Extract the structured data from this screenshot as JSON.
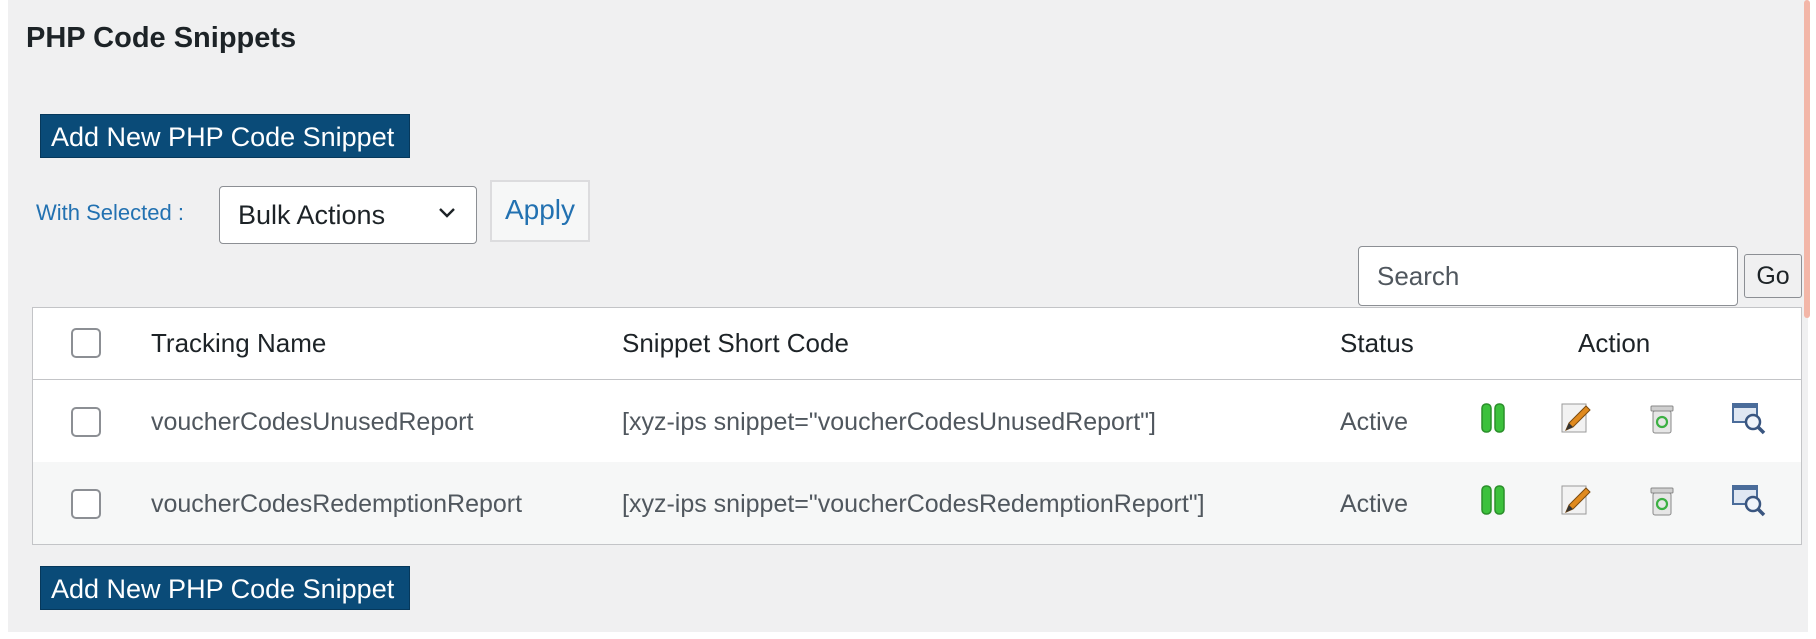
{
  "page_title": "PHP Code Snippets",
  "add_new_label": "Add New PHP Code Snippet",
  "with_selected_label": "With Selected :",
  "bulk_actions": {
    "selected": "Bulk Actions"
  },
  "apply_label": "Apply",
  "search": {
    "placeholder": "Search",
    "go_label": "Go"
  },
  "table": {
    "headers": {
      "name": "Tracking Name",
      "short_code": "Snippet Short Code",
      "status": "Status",
      "action": "Action"
    },
    "rows": [
      {
        "name": "voucherCodesUnusedReport",
        "short_code": "[xyz-ips snippet=\"voucherCodesUnusedReport\"]",
        "status": "Active"
      },
      {
        "name": "voucherCodesRedemptionReport",
        "short_code": "[xyz-ips snippet=\"voucherCodesRedemptionReport\"]",
        "status": "Active"
      }
    ],
    "action_icons": [
      "pause-icon",
      "edit-icon",
      "trash-icon",
      "preview-icon"
    ]
  },
  "colors": {
    "primary_button": "#0a4b78",
    "link": "#2271b1",
    "panel_bg": "#f0f0f1",
    "pause_green": "#3cc13c"
  }
}
